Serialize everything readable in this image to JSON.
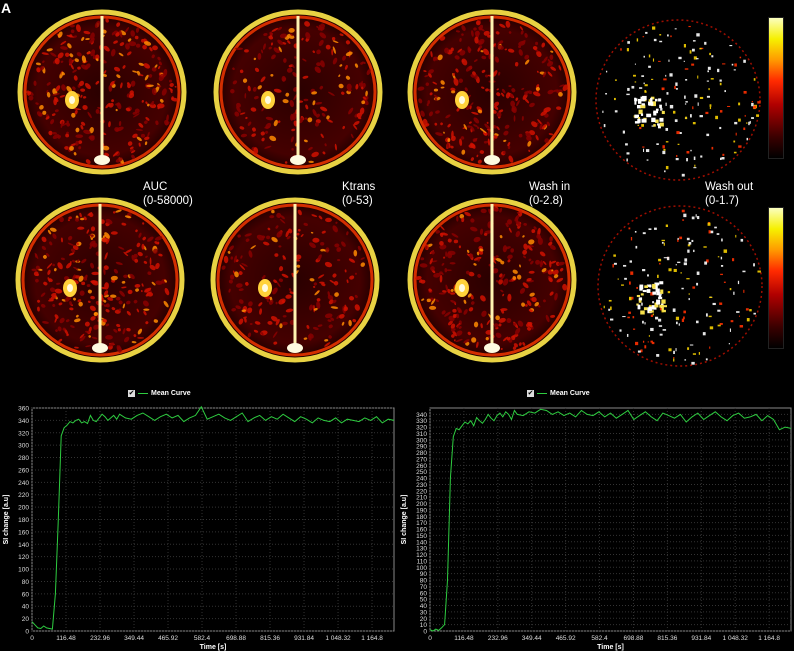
{
  "figure": {
    "panel_letter": "A",
    "maps_top": [
      {
        "label_line1": "AUC",
        "label_line2": "(0-58000)"
      },
      {
        "label_line1": "Ktrans",
        "label_line2": "(0-53)"
      },
      {
        "label_line1": "Wash in",
        "label_line2": "(0-2.8)"
      },
      {
        "label_line1": "Wash out",
        "label_line2": "(0-1.7)"
      }
    ],
    "colorbar_colors": [
      "#000000",
      "#b00000",
      "#ff2a00",
      "#ff9a00",
      "#f6f000",
      "#fbffc0"
    ]
  },
  "chart_data": [
    {
      "type": "line",
      "legend": "Mean Curve",
      "xlabel": "Time [s]",
      "ylabel": "SI change [a.u]",
      "xlim": [
        0,
        1240
      ],
      "ylim": [
        0,
        360
      ],
      "x_ticks": [
        "0",
        "116.48",
        "232.96",
        "349.44",
        "465.92",
        "582.4",
        "698.88",
        "815.36",
        "931.84",
        "1 048.32",
        "1 164.8"
      ],
      "y_ticks": [
        "0",
        "20",
        "40",
        "60",
        "80",
        "100",
        "120",
        "140",
        "160",
        "180",
        "200",
        "220",
        "240",
        "260",
        "280",
        "300",
        "320",
        "340",
        "360"
      ],
      "series": [
        {
          "color": "#2ecc40",
          "x": [
            0,
            10,
            20,
            30,
            40,
            50,
            60,
            70,
            80,
            90,
            100,
            110,
            120,
            130,
            140,
            150,
            160,
            170,
            180,
            190,
            200,
            210,
            220,
            230,
            240,
            250,
            260,
            270,
            280,
            290,
            300,
            320,
            340,
            360,
            380,
            400,
            420,
            440,
            460,
            480,
            500,
            520,
            540,
            560,
            580,
            600,
            620,
            640,
            660,
            680,
            700,
            720,
            740,
            760,
            780,
            800,
            820,
            840,
            860,
            880,
            900,
            920,
            940,
            960,
            980,
            1000,
            1020,
            1040,
            1060,
            1080,
            1100,
            1120,
            1140,
            1160,
            1180,
            1200,
            1220,
            1240
          ],
          "y": [
            15,
            10,
            5,
            4,
            8,
            5,
            4,
            3,
            60,
            180,
            315,
            328,
            332,
            338,
            336,
            340,
            342,
            336,
            338,
            335,
            348,
            340,
            338,
            344,
            350,
            346,
            340,
            344,
            348,
            342,
            350,
            344,
            342,
            348,
            352,
            346,
            340,
            346,
            350,
            344,
            348,
            338,
            344,
            348,
            362,
            342,
            346,
            350,
            344,
            340,
            346,
            352,
            338,
            344,
            348,
            340,
            346,
            342,
            350,
            344,
            338,
            346,
            342,
            336,
            344,
            340,
            338,
            344,
            336,
            342,
            340,
            338,
            344,
            340,
            346,
            336,
            342,
            340
          ]
        }
      ]
    },
    {
      "type": "line",
      "legend": "Mean Curve",
      "xlabel": "Time [s]",
      "ylabel": "SI change [a.u]",
      "xlim": [
        0,
        1240
      ],
      "ylim": [
        0,
        350
      ],
      "x_ticks": [
        "0",
        "116.48",
        "232.96",
        "349.44",
        "465.92",
        "582.4",
        "698.88",
        "815.36",
        "931.84",
        "1 048.32",
        "1 164.8"
      ],
      "y_ticks": [
        "0",
        "10",
        "20",
        "30",
        "40",
        "50",
        "60",
        "70",
        "80",
        "90",
        "100",
        "110",
        "120",
        "130",
        "140",
        "150",
        "160",
        "170",
        "180",
        "190",
        "200",
        "210",
        "220",
        "230",
        "240",
        "250",
        "260",
        "270",
        "280",
        "290",
        "300",
        "310",
        "320",
        "330",
        "340"
      ],
      "series": [
        {
          "color": "#2ecc40",
          "x": [
            0,
            10,
            20,
            30,
            40,
            50,
            60,
            70,
            80,
            90,
            100,
            110,
            120,
            130,
            140,
            150,
            160,
            170,
            180,
            190,
            200,
            210,
            220,
            230,
            240,
            250,
            260,
            270,
            280,
            290,
            300,
            320,
            340,
            360,
            380,
            400,
            420,
            440,
            460,
            480,
            500,
            520,
            540,
            560,
            580,
            600,
            620,
            640,
            660,
            680,
            700,
            720,
            740,
            760,
            780,
            800,
            820,
            840,
            860,
            880,
            900,
            920,
            940,
            960,
            980,
            1000,
            1020,
            1040,
            1060,
            1080,
            1100,
            1120,
            1140,
            1160,
            1180,
            1200,
            1220,
            1240
          ],
          "y": [
            2,
            0,
            3,
            1,
            5,
            10,
            80,
            240,
            305,
            318,
            316,
            322,
            328,
            325,
            330,
            322,
            335,
            330,
            326,
            332,
            340,
            334,
            330,
            338,
            342,
            336,
            344,
            340,
            332,
            346,
            340,
            338,
            344,
            342,
            348,
            346,
            340,
            344,
            338,
            342,
            336,
            346,
            340,
            338,
            344,
            336,
            342,
            334,
            340,
            346,
            332,
            338,
            344,
            336,
            330,
            342,
            338,
            334,
            340,
            328,
            336,
            342,
            332,
            338,
            344,
            336,
            330,
            338,
            342,
            334,
            336,
            340,
            330,
            338,
            332,
            316,
            320,
            318
          ]
        }
      ]
    }
  ]
}
